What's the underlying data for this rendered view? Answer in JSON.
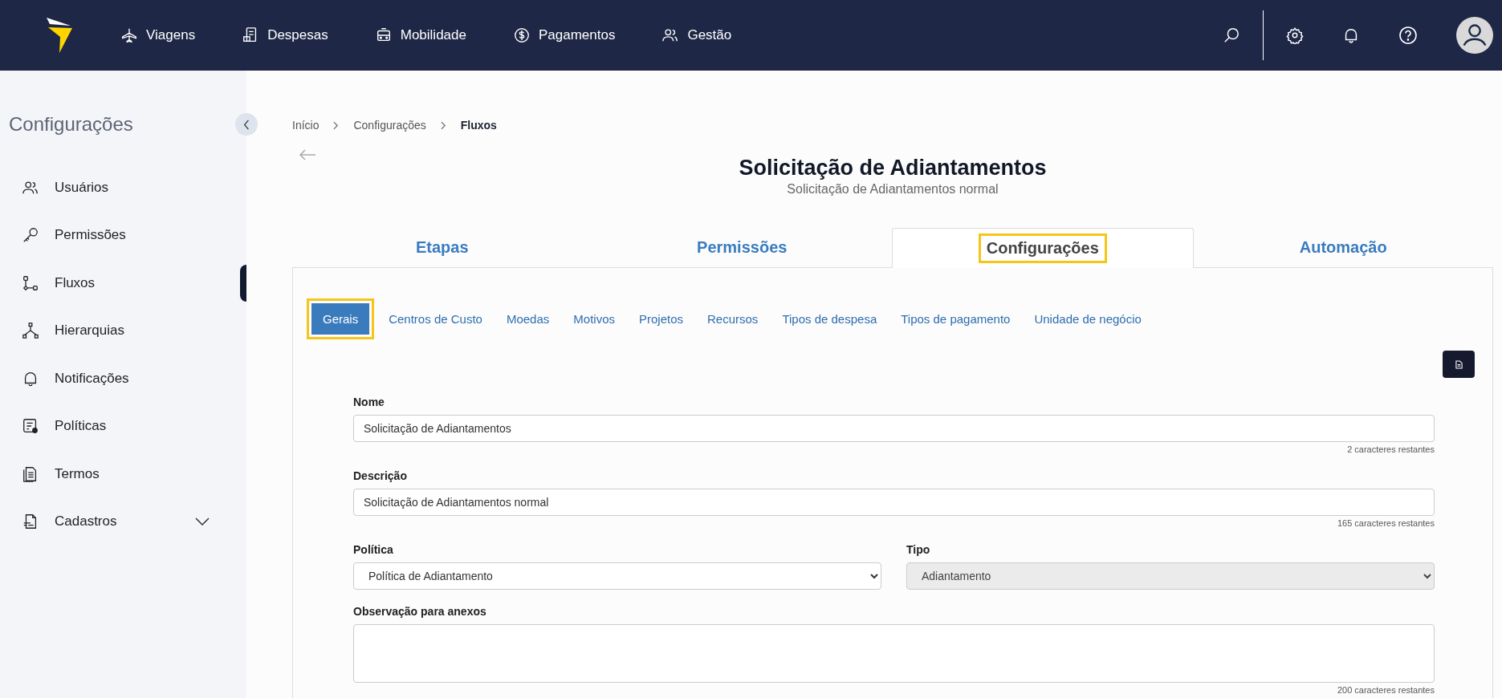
{
  "topbar": {
    "nav": [
      {
        "label": "Viagens"
      },
      {
        "label": "Despesas"
      },
      {
        "label": "Mobilidade"
      },
      {
        "label": "Pagamentos"
      },
      {
        "label": "Gestão"
      }
    ]
  },
  "sidebar": {
    "title": "Configurações",
    "items": [
      {
        "label": "Usuários",
        "kind": "link",
        "selected": false
      },
      {
        "label": "Permissões",
        "kind": "link",
        "selected": false
      },
      {
        "label": "Fluxos",
        "kind": "link",
        "selected": true
      },
      {
        "label": "Hierarquias",
        "kind": "link",
        "selected": false
      },
      {
        "label": "Notificações",
        "kind": "link",
        "selected": false
      },
      {
        "label": "Políticas",
        "kind": "link",
        "selected": false
      },
      {
        "label": "Termos",
        "kind": "link",
        "selected": false
      },
      {
        "label": "Cadastros",
        "kind": "group",
        "selected": false
      }
    ]
  },
  "breadcrumb": [
    "Início",
    "Configurações",
    "Fluxos"
  ],
  "header": {
    "title": "Solicitação de Adiantamentos",
    "subtitle": "Solicitação de Adiantamentos normal"
  },
  "tabs": [
    {
      "label": "Etapas",
      "selected": false,
      "highlighted": false
    },
    {
      "label": "Permissões",
      "selected": false,
      "highlighted": false
    },
    {
      "label": "Configurações",
      "selected": true,
      "highlighted": true
    },
    {
      "label": "Automação",
      "selected": false,
      "highlighted": false
    }
  ],
  "subtabs": [
    {
      "label": "Gerais",
      "selected": true,
      "highlighted": true
    },
    {
      "label": "Centros de Custo",
      "selected": false,
      "highlighted": false
    },
    {
      "label": "Moedas",
      "selected": false,
      "highlighted": false
    },
    {
      "label": "Motivos",
      "selected": false,
      "highlighted": false
    },
    {
      "label": "Projetos",
      "selected": false,
      "highlighted": false
    },
    {
      "label": "Recursos",
      "selected": false,
      "highlighted": false
    },
    {
      "label": "Tipos de despesa",
      "selected": false,
      "highlighted": false
    },
    {
      "label": "Tipos de pagamento",
      "selected": false,
      "highlighted": false
    },
    {
      "label": "Unidade de negócio",
      "selected": false,
      "highlighted": false
    }
  ],
  "form": {
    "rows": [
      [
        {
          "kind": "text",
          "label": "Nome",
          "value": "Solicitação de Adiantamentos",
          "counter": "2 caracteres restantes"
        }
      ],
      [
        {
          "kind": "text",
          "label": "Descrição",
          "value": "Solicitação de Adiantamentos normal",
          "counter": "165 caracteres restantes"
        }
      ],
      [
        {
          "kind": "select",
          "label": "Política",
          "value": "Política de Adiantamento",
          "disabled": false
        },
        {
          "kind": "select",
          "label": "Tipo",
          "value": "Adiantamento",
          "disabled": true
        }
      ],
      [
        {
          "kind": "textarea",
          "label": "Observação para anexos",
          "counter": "200 caracteres restantes"
        }
      ]
    ]
  }
}
